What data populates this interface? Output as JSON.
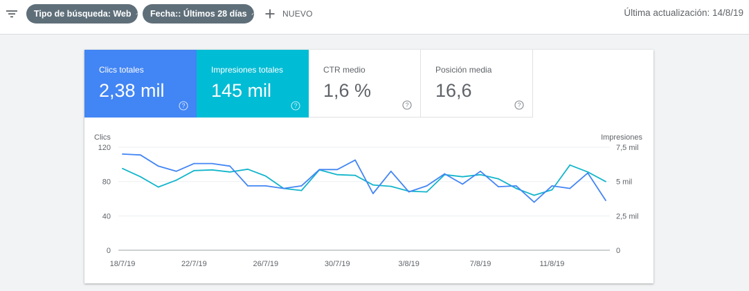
{
  "toolbar": {
    "filter_icon": "filter-list-icon",
    "chips": [
      {
        "label": "Tipo de búsqueda: Web",
        "icon": "pencil-icon"
      },
      {
        "label": "Fecha:: Últimos 28 días",
        "icon": "pencil-icon"
      }
    ],
    "new_label": "NUEVO",
    "new_icon": "plus-icon",
    "last_update": "Última actualización: 14/8/19"
  },
  "metrics": [
    {
      "label": "Clics totales",
      "value": "2,38 mil",
      "selected": true,
      "color": "#4285f4"
    },
    {
      "label": "Impresiones totales",
      "value": "145 mil",
      "selected": true,
      "color": "#00bcd4"
    },
    {
      "label": "CTR medio",
      "value": "1,6 %",
      "selected": false
    },
    {
      "label": "Posición media",
      "value": "16,6",
      "selected": false
    }
  ],
  "chart_data": {
    "type": "line",
    "left_axis_label": "Clics",
    "right_axis_label": "Impresiones",
    "left_ticks": [
      "0",
      "40",
      "80",
      "120"
    ],
    "right_ticks": [
      "0",
      "2,5 mil",
      "5 mil",
      "7,5 mil"
    ],
    "left_range": [
      0,
      120
    ],
    "right_range": [
      0,
      7500
    ],
    "x_tick_labels": [
      "18/7/19",
      "22/7/19",
      "26/7/19",
      "30/7/19",
      "3/8/19",
      "7/8/19",
      "11/8/19"
    ],
    "x": [
      "18/7/19",
      "19/7/19",
      "20/7/19",
      "21/7/19",
      "22/7/19",
      "23/7/19",
      "24/7/19",
      "25/7/19",
      "26/7/19",
      "27/7/19",
      "28/7/19",
      "29/7/19",
      "30/7/19",
      "31/7/19",
      "1/8/19",
      "2/8/19",
      "3/8/19",
      "4/8/19",
      "5/8/19",
      "6/8/19",
      "7/8/19",
      "8/8/19",
      "9/8/19",
      "10/8/19",
      "11/8/19",
      "12/8/19",
      "13/8/19",
      "14/8/19"
    ],
    "grid": true,
    "series": [
      {
        "name": "Clics",
        "axis": "left",
        "color": "#4285f4",
        "values": [
          112,
          111,
          98,
          92,
          101,
          101,
          98,
          75,
          75,
          72,
          75,
          94,
          94,
          105,
          66,
          92,
          68,
          75,
          89,
          77,
          92,
          74,
          75,
          56,
          75,
          72,
          90,
          58
        ]
      },
      {
        "name": "Impresiones",
        "axis": "right",
        "color": "#12b5cb",
        "values": [
          5950,
          5350,
          4600,
          5100,
          5800,
          5850,
          5700,
          5900,
          5400,
          4500,
          4350,
          5850,
          5500,
          5450,
          4750,
          4650,
          4300,
          4250,
          5500,
          5350,
          5500,
          5200,
          4500,
          4000,
          4400,
          6200,
          5700,
          5000
        ]
      }
    ]
  }
}
